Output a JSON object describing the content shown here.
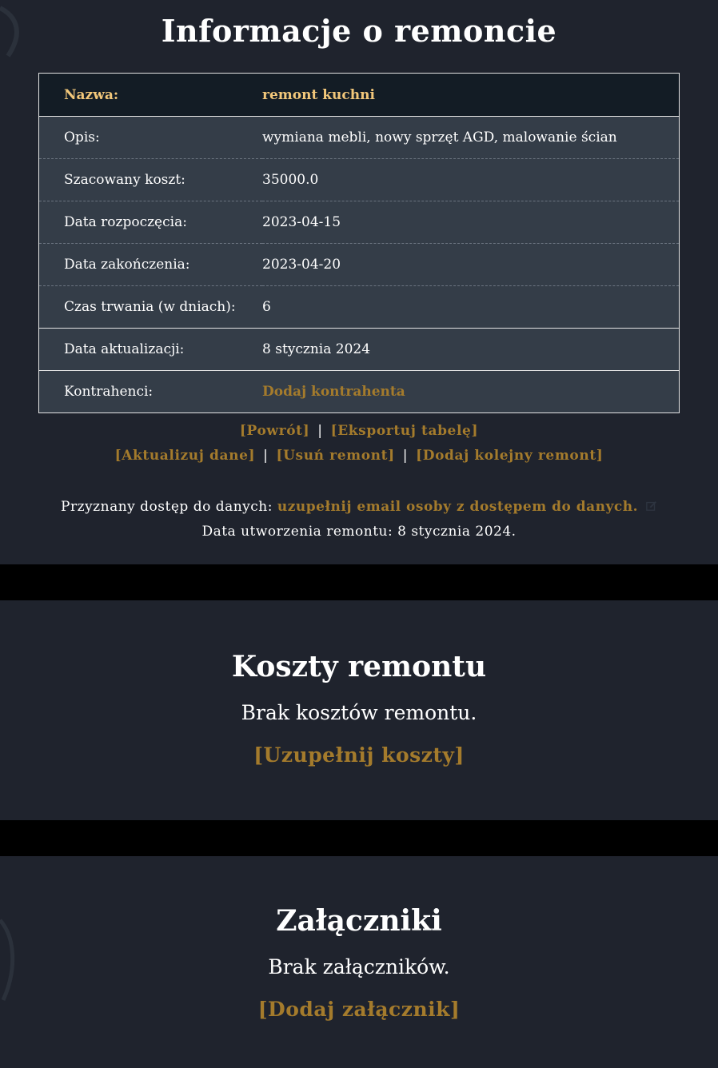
{
  "info": {
    "title": "Informacje o remoncie",
    "rows": [
      {
        "label": "Nazwa:",
        "value": "remont kuchni"
      },
      {
        "label": "Opis:",
        "value": "wymiana mebli, nowy sprzęt AGD, malowanie ścian"
      },
      {
        "label": "Szacowany koszt:",
        "value": "35000.0"
      },
      {
        "label": "Data rozpoczęcia:",
        "value": "2023-04-15"
      },
      {
        "label": "Data zakończenia:",
        "value": "2023-04-20"
      },
      {
        "label": "Czas trwania (w dniach):",
        "value": "6"
      },
      {
        "label": "Data aktualizacji:",
        "value": "8 stycznia 2024"
      },
      {
        "label": "Kontrahenci:",
        "value": "Dodaj kontrahenta"
      }
    ]
  },
  "actions": {
    "back": "[Powrót]",
    "export": "[Eksportuj tabelę]",
    "update": "[Aktualizuj dane]",
    "delete": "[Usuń remont]",
    "add_another": "[Dodaj kolejny remont]",
    "separator": "|"
  },
  "access": {
    "label": "Przyznany dostęp do danych:",
    "link": "uzupełnij email osoby z dostępem do danych.",
    "created_text": "Data utworzenia remontu: 8 stycznia 2024."
  },
  "costs": {
    "title": "Koszty remontu",
    "empty": "Brak kosztów remontu.",
    "link": "[Uzupełnij koszty]"
  },
  "attachments": {
    "title": "Załączniki",
    "empty": "Brak załączników.",
    "link": "[Dodaj załącznik]"
  },
  "colors": {
    "panel_bg": "#1f232d",
    "row_bg": "#343d48",
    "header_bg": "#131c25",
    "header_text": "#f2c77a",
    "link": "#a47b2c"
  },
  "icons": {
    "edit": "edit-icon"
  }
}
